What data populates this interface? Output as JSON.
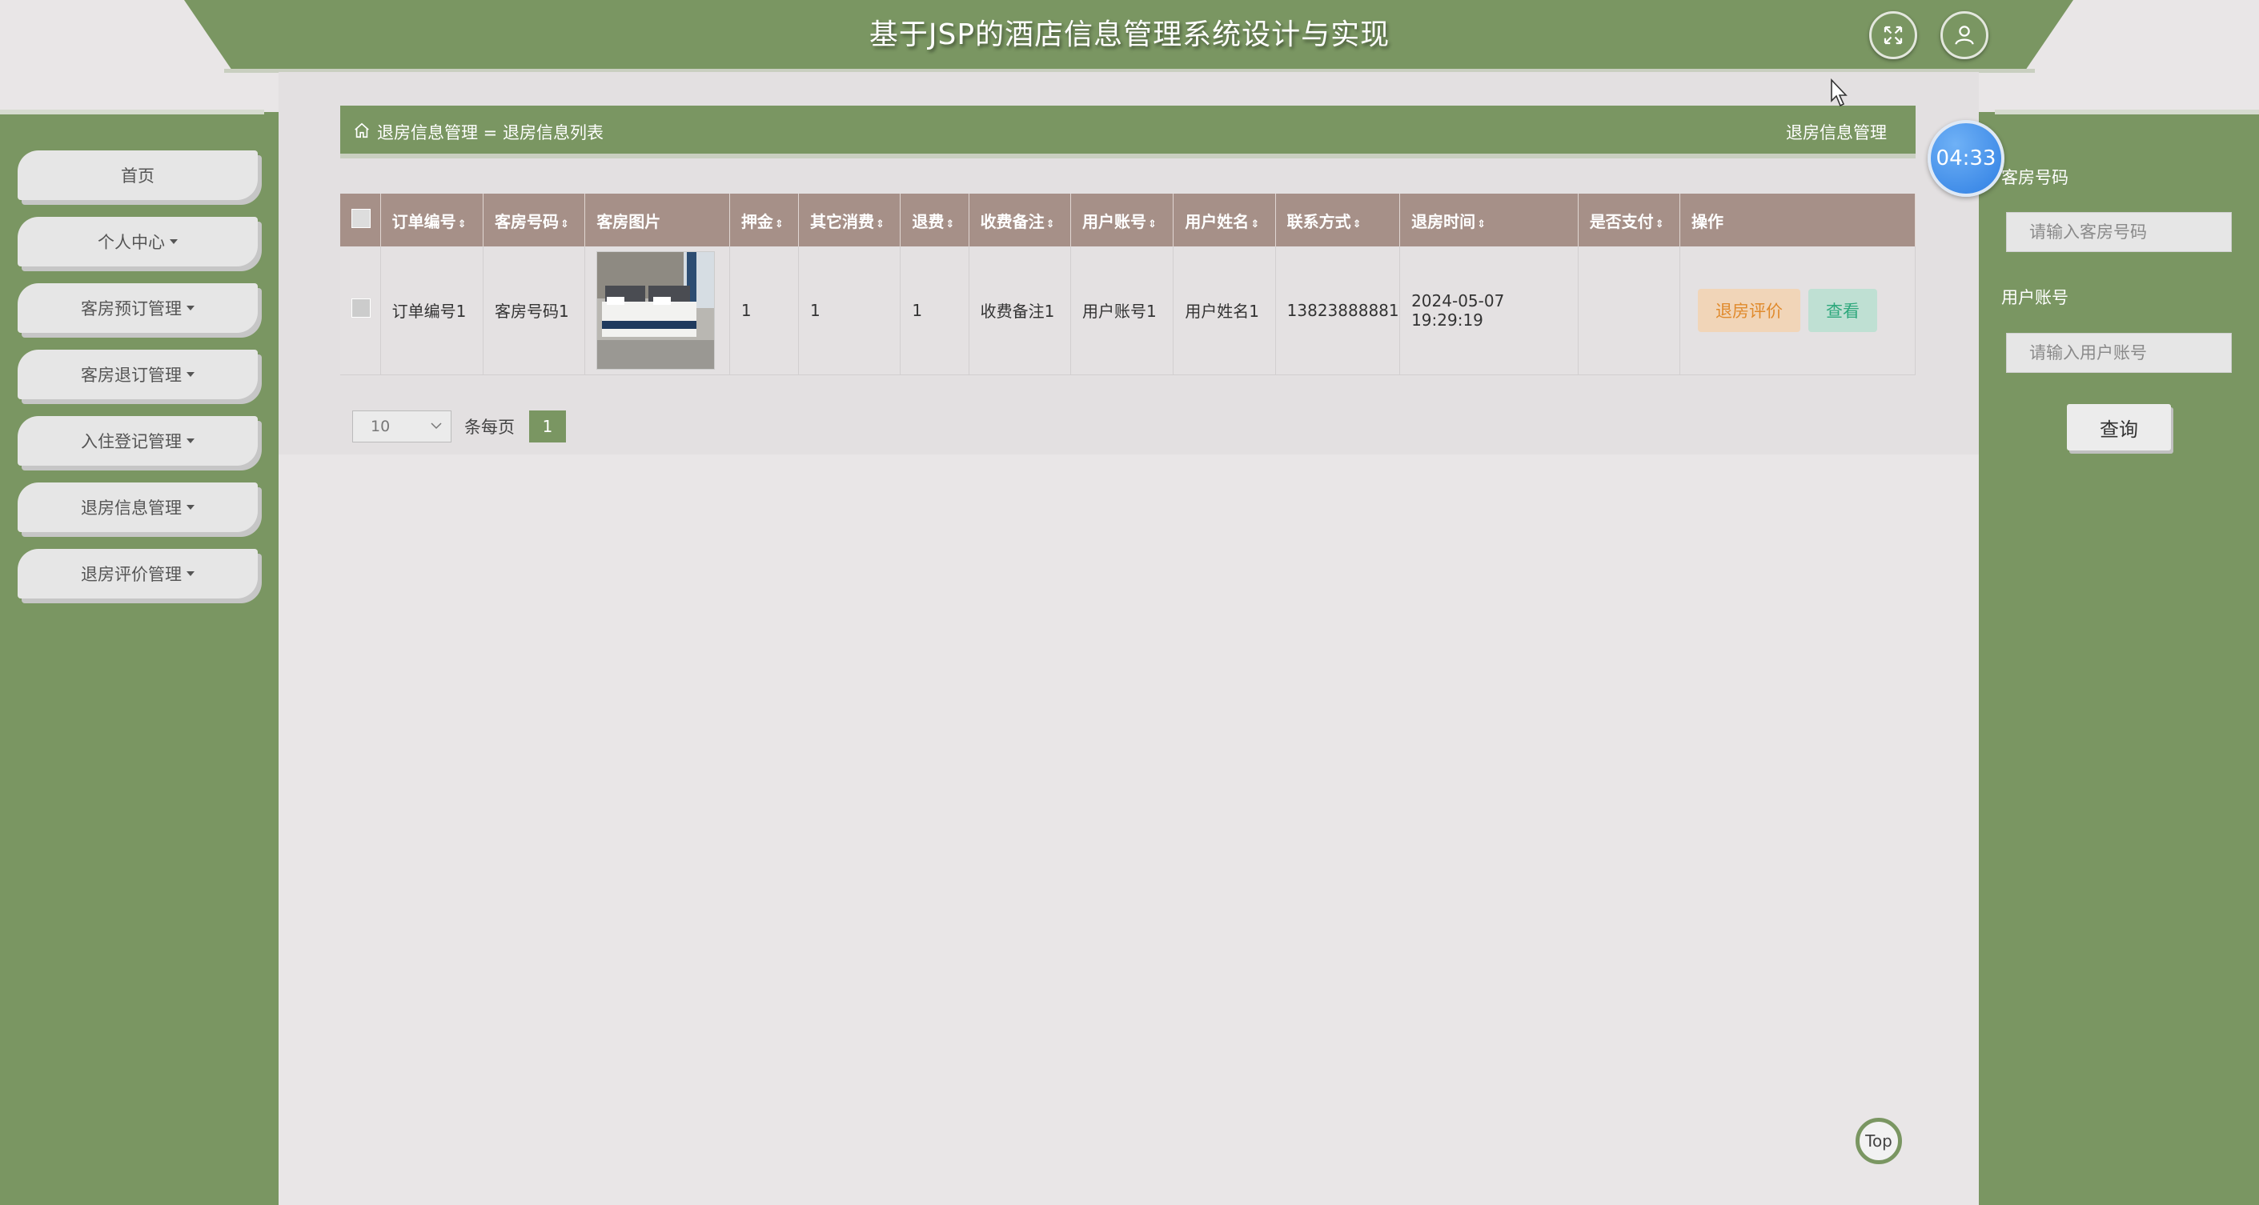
{
  "header": {
    "title": "基于JSP的酒店信息管理系统设计与实现"
  },
  "sidebar": {
    "items": [
      {
        "label": "首页",
        "dropdown": false
      },
      {
        "label": "个人中心",
        "dropdown": true
      },
      {
        "label": "客房预订管理",
        "dropdown": true
      },
      {
        "label": "客房退订管理",
        "dropdown": true
      },
      {
        "label": "入住登记管理",
        "dropdown": true
      },
      {
        "label": "退房信息管理",
        "dropdown": true
      },
      {
        "label": "退房评价管理",
        "dropdown": true
      }
    ]
  },
  "breadcrumb": {
    "path": "退房信息管理 = 退房信息列表",
    "right_title": "退房信息管理"
  },
  "table": {
    "headers": [
      "订单编号",
      "客房号码",
      "客房图片",
      "押金",
      "其它消费",
      "退费",
      "收费备注",
      "用户账号",
      "用户姓名",
      "联系方式",
      "退房时间",
      "是否支付",
      "操作"
    ],
    "rows": [
      {
        "order_no": "订单编号1",
        "room_no": "客房号码1",
        "deposit": "1",
        "other_cost": "1",
        "refund": "1",
        "fee_note": "收费备注1",
        "user_account": "用户账号1",
        "user_name": "用户姓名1",
        "phone": "13823888881",
        "checkout_time": "2024-05-07 19:29:19",
        "paid": "",
        "actions": {
          "review": "退房评价",
          "view": "查看"
        }
      }
    ]
  },
  "pager": {
    "page_size": "10",
    "per_page_label": "条每页",
    "current_page": "1"
  },
  "search": {
    "room_label": "客房号码",
    "room_placeholder": "请输入客房号码",
    "account_label": "用户账号",
    "account_placeholder": "请输入用户账号",
    "button": "查询"
  },
  "timer": "04:33",
  "top_button": "Top",
  "colors": {
    "primary_green": "#7a9662",
    "table_header": "#a69088",
    "review_button": "#e08a2c",
    "view_button": "#2ea87c"
  }
}
